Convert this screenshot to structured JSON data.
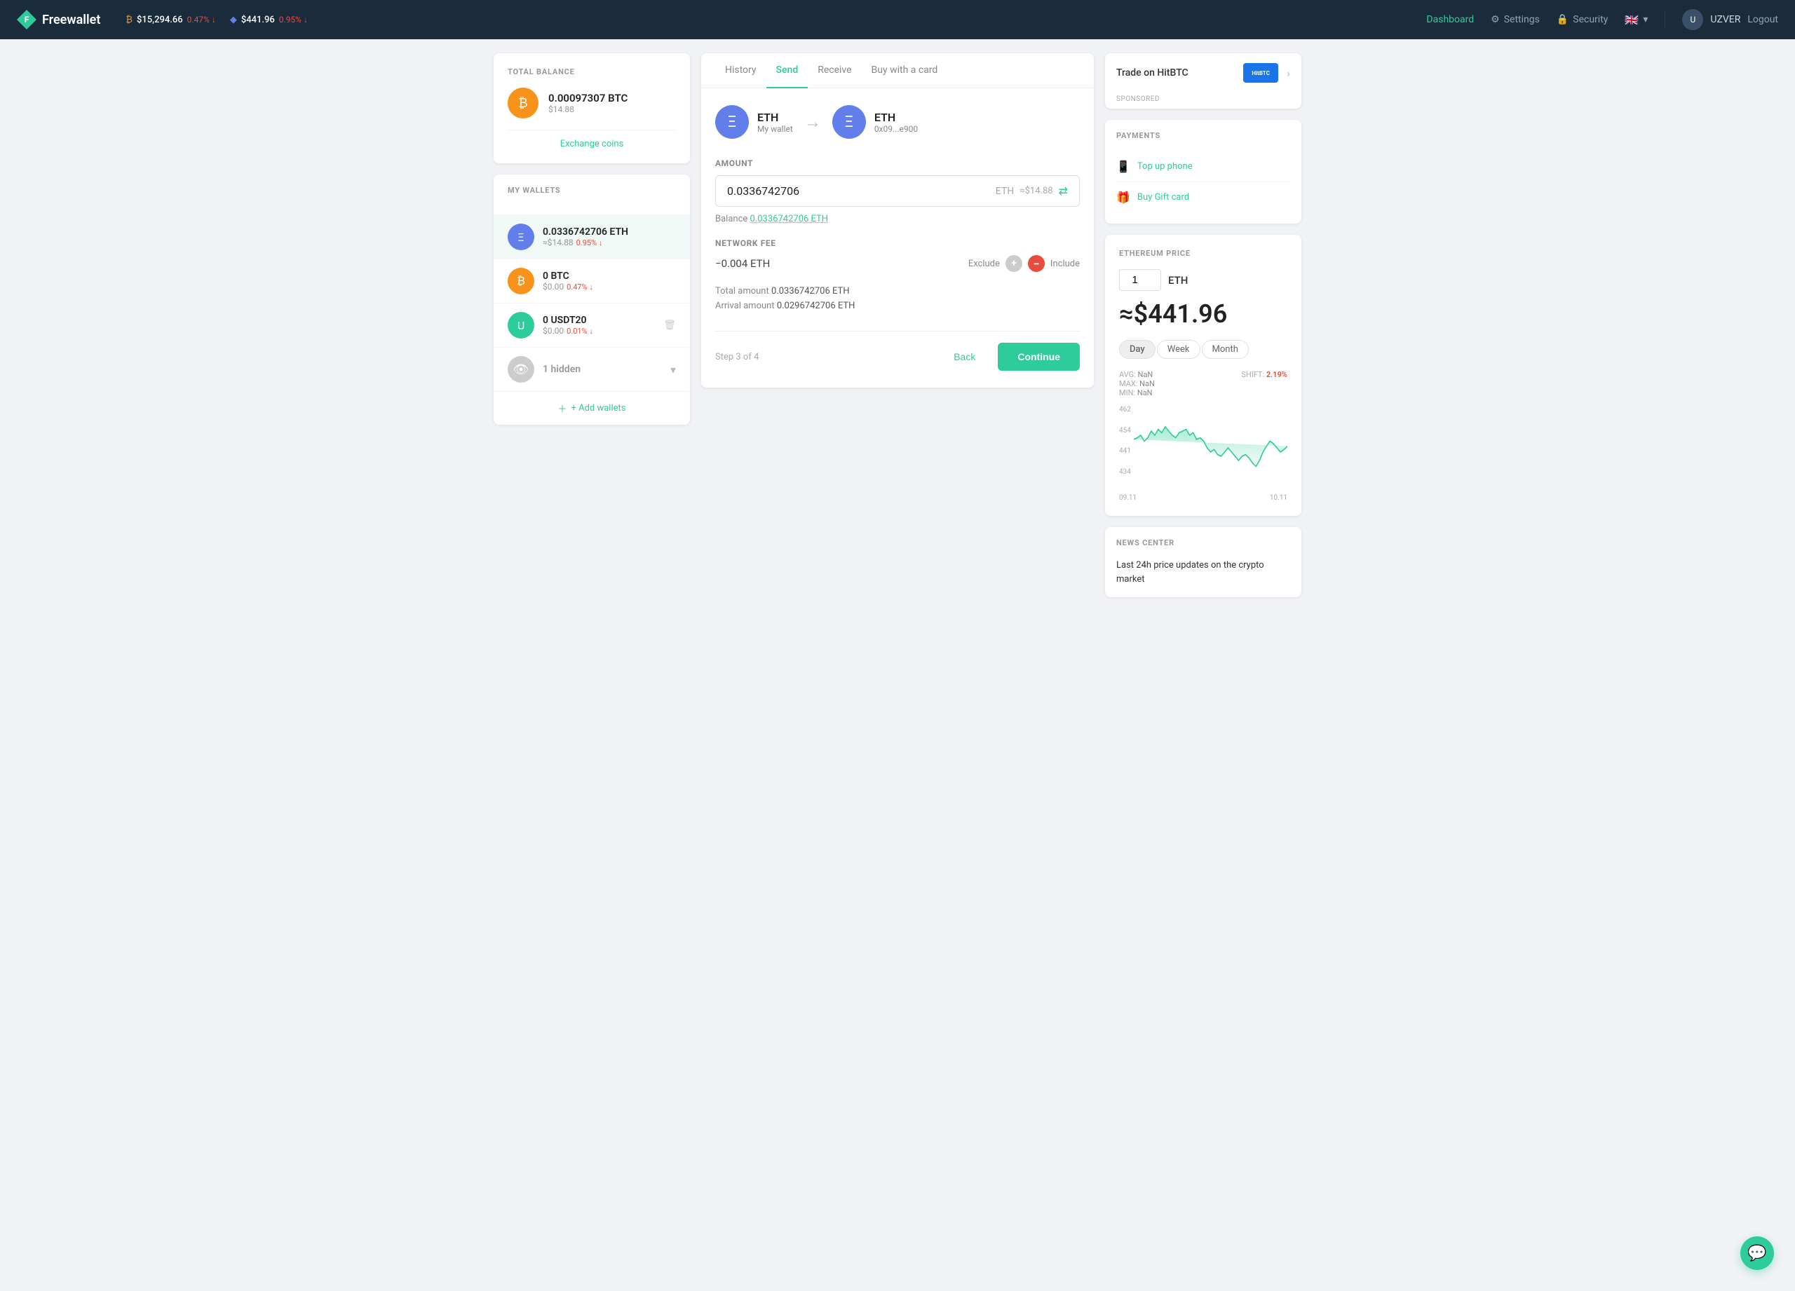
{
  "header": {
    "logo_text": "Freewallet",
    "btc_price": "$15,294.66",
    "btc_change": "0.47%",
    "eth_price": "$441.96",
    "eth_change": "0.95%",
    "nav_items": [
      {
        "label": "Dashboard",
        "active": false
      },
      {
        "label": "Settings",
        "active": false
      },
      {
        "label": "Security",
        "active": false
      }
    ],
    "username": "UZVER",
    "logout": "Logout"
  },
  "left_panel": {
    "total_balance_title": "TOTAL BALANCE",
    "total_balance_amount": "0.00097307 BTC",
    "total_balance_usd": "$14.88",
    "exchange_link": "Exchange coins",
    "wallets_title": "MY WALLETS",
    "wallets": [
      {
        "name": "ETH",
        "amount": "0.0336742706 ETH",
        "usd": "≈$14.88",
        "change": "0.95%",
        "change_dir": "down",
        "active": true
      },
      {
        "name": "BTC",
        "amount": "0 BTC",
        "usd": "$0.00",
        "change": "0.47%",
        "change_dir": "down",
        "active": false
      },
      {
        "name": "USDT20",
        "amount": "0 USDT20",
        "usd": "$0.00",
        "change": "0.01%",
        "change_dir": "down",
        "active": false
      },
      {
        "name": "hidden",
        "amount": "1 hidden",
        "usd": "",
        "change": "",
        "active": false
      }
    ],
    "add_wallets": "+ Add wallets"
  },
  "center_panel": {
    "tabs": [
      "History",
      "Send",
      "Receive",
      "Buy with a card"
    ],
    "active_tab": "Send",
    "from_coin": "ETH",
    "from_label": "My wallet",
    "to_coin": "ETH",
    "to_address": "0x09...e900",
    "amount_label": "AMOUNT",
    "amount_value": "0.0336742706",
    "amount_currency": "ETH",
    "amount_usd": "≈$14.88",
    "balance_label": "Balance",
    "balance_value": "0.0336742706 ETH",
    "network_fee_label": "NETWORK FEE",
    "fee_value": "−0.004 ETH",
    "exclude_label": "Exclude",
    "include_label": "Include",
    "total_amount_label": "Total amount",
    "total_amount_value": "0.0336742706 ETH",
    "arrival_amount_label": "Arrival amount",
    "arrival_amount_value": "0.0296742706 ETH",
    "step_info": "Step 3 of 4",
    "back_button": "Back",
    "continue_button": "Continue"
  },
  "right_panel": {
    "trade_text": "Trade on HitBTC",
    "sponsored": "SPONSORED",
    "payments_title": "PAYMENTS",
    "payment_items": [
      {
        "label": "Top up phone",
        "icon": "📱"
      },
      {
        "label": "Buy Gift card",
        "icon": "🎁"
      }
    ],
    "eth_price_title": "ETHEREUM PRICE",
    "eth_qty": "1",
    "eth_label": "ETH",
    "eth_price": "≈$441.96",
    "time_tabs": [
      "Day",
      "Week",
      "Month"
    ],
    "active_time_tab": "Day",
    "stats": {
      "avg_label": "AVG:",
      "avg_value": "NaN",
      "max_label": "MAX:",
      "max_value": "NaN",
      "min_label": "MIN:",
      "min_value": "NaN",
      "shift_label": "SHIFT:",
      "shift_value": "2.19%"
    },
    "chart_y_labels": [
      "462",
      "454",
      "441",
      "434"
    ],
    "chart_x_labels": [
      "09.11",
      "10.11"
    ],
    "news_title": "NEWS CENTER",
    "news_text": "Last 24h price updates on the crypto market"
  }
}
